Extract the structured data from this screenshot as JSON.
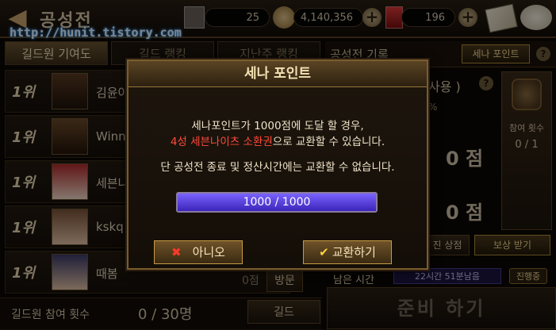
{
  "header": {
    "title": "공성전",
    "resources": [
      {
        "icon": "castle-icon",
        "value": "25"
      },
      {
        "icon": "gold-coin-icon",
        "value": "4,140,356"
      },
      {
        "icon": "ruby-gem-icon",
        "value": "196"
      }
    ],
    "watermark": "http://hunit.tistory.com"
  },
  "left_panel": {
    "tabs": [
      {
        "label": "길드원 기여도",
        "active": true
      },
      {
        "label": "길드 랭킹",
        "active": false
      },
      {
        "label": "지난주 랭킹",
        "active": false
      }
    ],
    "rows": [
      {
        "rank": "1위",
        "name": "김윤아"
      },
      {
        "rank": "1위",
        "name": "Winn"
      },
      {
        "rank": "1위",
        "name": "세븐나"
      },
      {
        "rank": "1위",
        "name": "kskq"
      },
      {
        "rank": "1위",
        "name": "때봄",
        "score": "0점",
        "action": "방문"
      }
    ],
    "footer": {
      "label": "길드원 참여 횟수",
      "count": "0 / 30명",
      "button": "길드"
    }
  },
  "right_panel": {
    "header_label": "공성전 기록",
    "point_button": "세나 포인트",
    "partial_label": "사용 )",
    "percent_fragment": "%",
    "participation_label": "참여 횟수",
    "participation_value": "0 / 1",
    "scores": [
      "0 점",
      "0 점"
    ],
    "reward_partial": "진 상점",
    "reward_button": "보상 받기",
    "time_label": "남은 시간",
    "time_value": "22시간 51분남음",
    "status_badge": "진행중",
    "ready_button": "준비 하기"
  },
  "modal": {
    "title": "세나 포인트",
    "line1": "세나포인트가 1000점에 도달 할 경우,",
    "line2_highlight": "4성 세븐나이츠 소환권",
    "line2_rest": "으로 교환할 수 있습니다.",
    "line3": "단 공성전 종료 및 정산시간에는 교환할 수 없습니다.",
    "progress": {
      "current": 1000,
      "max": 1000,
      "label": "1000 / 1000"
    },
    "cancel_button": "아니오",
    "confirm_button": "교환하기"
  },
  "colors": {
    "highlight": "#ff4a3a",
    "gold": "#c59a45",
    "progress": "#5a40e0"
  }
}
